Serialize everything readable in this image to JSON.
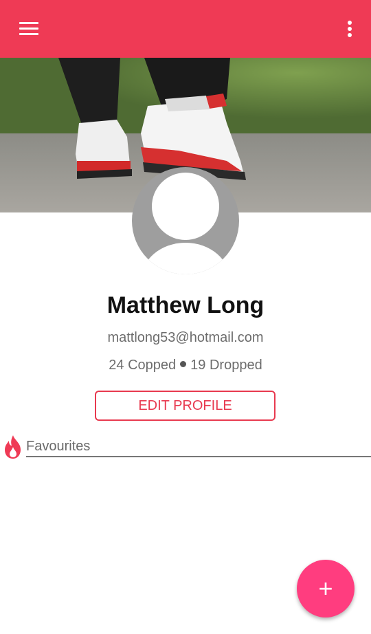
{
  "appbar": {
    "menu_icon": "hamburger-menu-icon",
    "more_icon": "more-vert-icon",
    "color": "#ef3a55"
  },
  "profile": {
    "name": "Matthew Long",
    "email": "mattlong53@hotmail.com",
    "copped": "24 Copped",
    "dropped": "19 Dropped",
    "edit_label": "EDIT PROFILE"
  },
  "favourites": {
    "icon": "flame-icon",
    "label": "Favourites"
  },
  "fab": {
    "icon": "plus-icon",
    "label": "+",
    "color": "#ff3d7f"
  }
}
